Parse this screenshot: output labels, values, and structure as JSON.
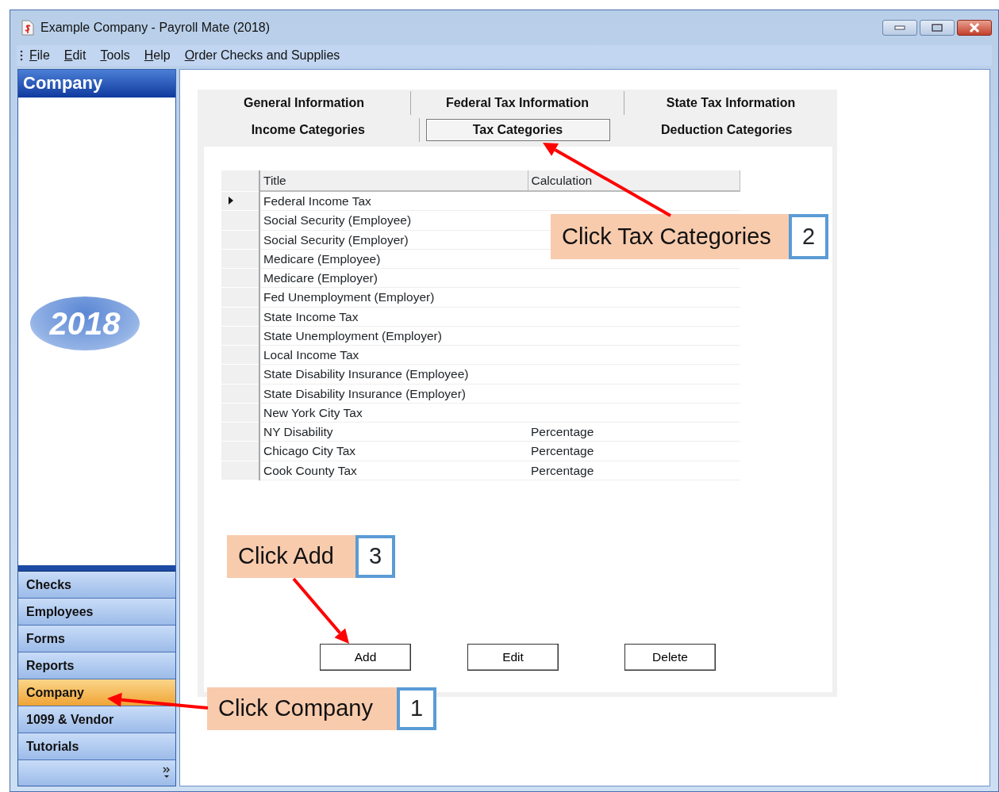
{
  "window": {
    "title": "Example Company - Payroll Mate (2018)"
  },
  "menu": [
    {
      "label": "File"
    },
    {
      "label": "Edit"
    },
    {
      "label": "Tools"
    },
    {
      "label": "Help"
    },
    {
      "label": "Order Checks and Supplies"
    }
  ],
  "sidebar": {
    "header": "Company",
    "logo_text": "2018",
    "items": [
      {
        "label": "Checks",
        "selected": false
      },
      {
        "label": "Employees",
        "selected": false
      },
      {
        "label": "Forms",
        "selected": false
      },
      {
        "label": "Reports",
        "selected": false
      },
      {
        "label": "Company",
        "selected": true
      },
      {
        "label": "1099 & Vendor",
        "selected": false
      },
      {
        "label": "Tutorials",
        "selected": false
      }
    ]
  },
  "tabs": [
    [
      {
        "label": "General Information",
        "selected": false
      },
      {
        "label": "Federal Tax Information",
        "selected": false
      },
      {
        "label": "State Tax Information",
        "selected": false
      }
    ],
    [
      {
        "label": "Income Categories",
        "selected": false
      },
      {
        "label": "Tax Categories",
        "selected": true
      },
      {
        "label": "Deduction Categories",
        "selected": false
      }
    ]
  ],
  "table": {
    "columns": [
      "Title",
      "Calculation"
    ],
    "rows": [
      {
        "title": "Federal Income Tax",
        "current": true
      },
      {
        "title": "Social Security (Employee)",
        "current": false
      },
      {
        "title": "Social Security (Employer)",
        "current": false
      },
      {
        "title": "Medicare (Employee)",
        "current": false
      },
      {
        "title": "Medicare (Employer)",
        "current": false
      },
      {
        "title": "Fed Unemployment (Employer)",
        "current": false
      },
      {
        "title": "State Income Tax",
        "current": false
      },
      {
        "title": "State Unemployment (Employer)",
        "current": false
      },
      {
        "title": "Local Income Tax",
        "current": false
      },
      {
        "title": "State Disability Insurance (Employee)",
        "current": false
      },
      {
        "title": "State Disability Insurance (Employer)",
        "current": false
      },
      {
        "title": "New York City Tax",
        "current": false
      },
      {
        "title": "NY Disability",
        "calculation": "Percentage",
        "current": false
      },
      {
        "title": "Chicago City Tax",
        "calculation": "Percentage",
        "current": false
      },
      {
        "title": "Cook County Tax",
        "calculation": "Percentage",
        "current": false
      }
    ]
  },
  "buttons": [
    "Add",
    "Edit",
    "Delete"
  ],
  "annotations": [
    {
      "text": "Click Tax Categories",
      "number": "2"
    },
    {
      "text": "Click Add",
      "number": "3"
    },
    {
      "text": "Click Company",
      "number": "1"
    }
  ]
}
